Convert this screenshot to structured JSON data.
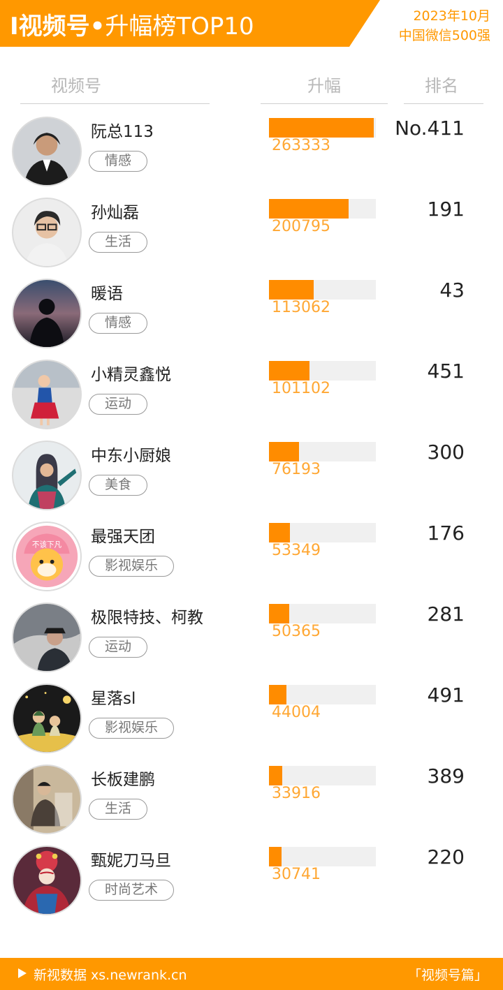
{
  "header": {
    "title_bold": "I视频号",
    "title_dot": "•",
    "title_rest": "升幅榜TOP10",
    "date": "2023年10月",
    "subtitle": "中国微信500强"
  },
  "columns": {
    "account": "视频号",
    "growth": "升幅",
    "rank": "排名"
  },
  "rows": [
    {
      "name": "阮总113",
      "tag": "情感",
      "value": "263333",
      "fill": 1.0,
      "rank": "No.411",
      "avatar_icon": "man-in-suit-avatar-icon"
    },
    {
      "name": "孙灿磊",
      "tag": "生活",
      "value": "200795",
      "fill": 0.762,
      "rank": "191",
      "avatar_icon": "man-with-glasses-avatar-icon"
    },
    {
      "name": "暖语",
      "tag": "情感",
      "value": "113062",
      "fill": 0.429,
      "rank": "43",
      "avatar_icon": "silhouette-sunset-avatar-icon"
    },
    {
      "name": "小精灵鑫悦",
      "tag": "运动",
      "value": "101102",
      "fill": 0.384,
      "rank": "451",
      "avatar_icon": "girl-dancer-avatar-icon"
    },
    {
      "name": "中东小厨娘",
      "tag": "美食",
      "value": "76193",
      "fill": 0.289,
      "rank": "300",
      "avatar_icon": "woman-hijab-avatar-icon"
    },
    {
      "name": "最强天团",
      "tag": "影视娱乐",
      "value": "53349",
      "fill": 0.203,
      "rank": "176",
      "avatar_icon": "shiba-dog-cartoon-avatar-icon"
    },
    {
      "name": "极限特技、柯教",
      "tag": "运动",
      "value": "50365",
      "fill": 0.191,
      "rank": "281",
      "avatar_icon": "man-with-hat-avatar-icon"
    },
    {
      "name": "星落sl",
      "tag": "影视娱乐",
      "value": "44004",
      "fill": 0.167,
      "rank": "491",
      "avatar_icon": "couple-illustration-avatar-icon"
    },
    {
      "name": "长板建鹏",
      "tag": "生活",
      "value": "33916",
      "fill": 0.129,
      "rank": "389",
      "avatar_icon": "man-in-alley-avatar-icon"
    },
    {
      "name": "甄妮刀马旦",
      "tag": "时尚艺术",
      "value": "30741",
      "fill": 0.117,
      "rank": "220",
      "avatar_icon": "opera-performer-avatar-icon"
    }
  ],
  "avatar_badge_text": "不该下凡",
  "footer": {
    "brand": "新视数据 xs.newrank.cn",
    "section": "「视频号篇」"
  },
  "colors": {
    "accent": "#ff9800",
    "bar": "#ff8c00",
    "bar_bg": "#f0f0f0",
    "value_text": "#ffa733"
  }
}
